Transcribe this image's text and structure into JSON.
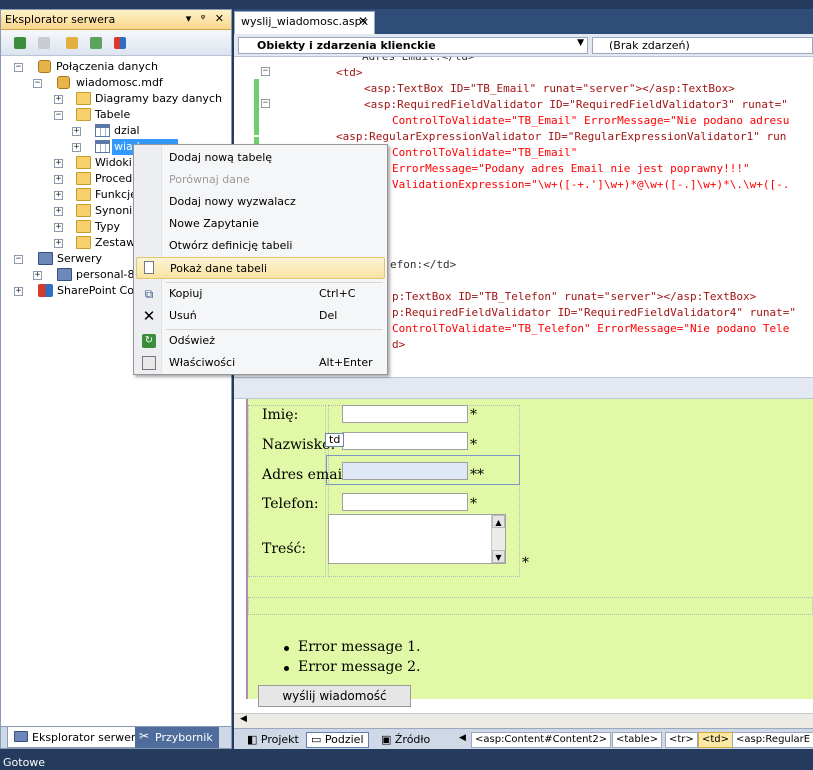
{
  "server_explorer": {
    "title": "Eksplorator serwera",
    "title_controls": "▾ ᵠ ✕",
    "tree": [
      {
        "label": "Połączenia danych"
      },
      {
        "label": "wiadomosc.mdf"
      },
      {
        "label": "Diagramy bazy danych"
      },
      {
        "label": "Tabele"
      },
      {
        "label": "dzial"
      },
      {
        "label": "wiadomosc"
      },
      {
        "label": "Widoki"
      },
      {
        "label": "Procedu"
      },
      {
        "label": "Funkcje"
      },
      {
        "label": "Synonim"
      },
      {
        "label": "Typy"
      },
      {
        "label": "Zestawy"
      },
      {
        "label": "Serwery"
      },
      {
        "label": "personal-83"
      },
      {
        "label": "SharePoint Conn"
      }
    ],
    "tabs": [
      {
        "label": "Eksplorator serwera"
      },
      {
        "label": "Przybornik"
      }
    ]
  },
  "context_menu": {
    "items": [
      {
        "label": "Dodaj nową tabelę",
        "shortcut": ""
      },
      {
        "label": "Porównaj dane",
        "shortcut": ""
      },
      {
        "label": "Dodaj nowy wyzwalacz",
        "shortcut": ""
      },
      {
        "label": "Nowe Zapytanie",
        "shortcut": ""
      },
      {
        "label": "Otwórz definicję tabeli",
        "shortcut": ""
      },
      {
        "label": "Pokaż dane tabeli",
        "shortcut": ""
      },
      {
        "label": "Kopiuj",
        "shortcut": "Ctrl+C"
      },
      {
        "label": "Usuń",
        "shortcut": "Del"
      },
      {
        "label": "Odśwież",
        "shortcut": ""
      },
      {
        "label": "Właściwości",
        "shortcut": "Alt+Enter"
      }
    ]
  },
  "editor": {
    "tab_title": "wyslij_wiadomosc.aspx",
    "tab_close": "✕",
    "left_dropdown": "Obiekty i zdarzenia klienckie",
    "right_dropdown": "(Brak zdarzeń)",
    "code_lines": [
      "Adres Email:</td>",
      "<td>",
      "<asp:TextBox ID=\"TB_Email\" runat=\"server\"></asp:TextBox>",
      "<asp:RequiredFieldValidator ID=\"RequiredFieldValidator3\" runat=\"",
      "ControlToValidate=\"TB_Email\" ErrorMessage=\"Nie podano adresu",
      "<asp:RegularExpressionValidator ID=\"RegularExpressionValidator1\" run",
      "ControlToValidate=\"TB_Email\"",
      "ErrorMessage=\"Podany adres Email nie jest poprawny!!!\"",
      "ValidationExpression=\"\\w+([-+.']\\w+)*@\\w+([-.]\\w+)*\\.\\w+([-.",
      "efon:</td>",
      "p:TextBox ID=\"TB_Telefon\" runat=\"server\"></asp:TextBox>",
      "p:RequiredFieldValidator ID=\"RequiredFieldValidator4\" runat=\"",
      "ControlToValidate=\"TB_Telefon\" ErrorMessage=\"Nie podano Tele",
      "d>"
    ]
  },
  "design": {
    "labels": {
      "imie": "Imię:",
      "nazwisko": "Nazwisko:",
      "email": "Adres email:",
      "telefon": "Telefon:",
      "tresc": "Treść:"
    },
    "star": "*",
    "double_star": "**",
    "td_tag": "td",
    "errors": [
      "Error message 1.",
      "Error message 2."
    ],
    "send_button": "wyślij wiadomość"
  },
  "view_bar": {
    "buttons": [
      "Projekt",
      "Podziel",
      "Źródło"
    ],
    "breadcrumbs": [
      "<asp:Content#Content2>",
      "<table>",
      "<tr>",
      "<td>",
      "<asp:RegularE"
    ]
  },
  "status": "Gotowe",
  "colors": {
    "design_bg": "#e1f8a6",
    "selection": "#3399ff",
    "menu_highlight": "#f8e4a2"
  }
}
